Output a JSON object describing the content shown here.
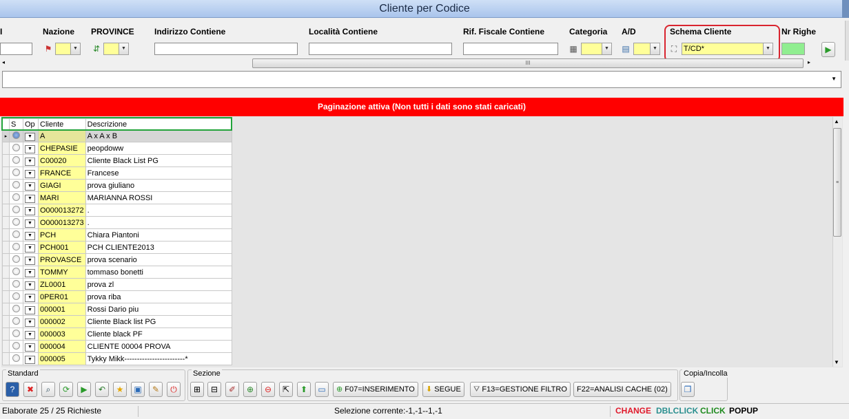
{
  "window": {
    "title": "Cliente per Codice"
  },
  "filters": {
    "nazione": "Nazione",
    "province": "PROVINCE",
    "indirizzo": "Indirizzo Contiene",
    "localita": "Località Contiene",
    "rif_fiscale": "Rif. Fiscale Contiene",
    "categoria": "Categoria",
    "ad": "A/D",
    "schema_cliente": "Schema Cliente",
    "schema_value": "T/CD*",
    "nr_righe": "Nr Righe",
    "left_fragment": "I"
  },
  "banner": "Paginazione attiva (Non tutti i dati sono stati caricati)",
  "grid": {
    "columns": [
      "S",
      "Op",
      "Cliente",
      "Descrizione"
    ],
    "rows": [
      {
        "cliente": "A",
        "descrizione": "A x A x B"
      },
      {
        "cliente": "CHEPASIE",
        "descrizione": "peopdoww"
      },
      {
        "cliente": "C00020",
        "descrizione": "Cliente Black List PG"
      },
      {
        "cliente": "FRANCE",
        "descrizione": "Francese"
      },
      {
        "cliente": "GIAGI",
        "descrizione": "prova giuliano"
      },
      {
        "cliente": "MARI",
        "descrizione": "MARIANNA ROSSI"
      },
      {
        "cliente": "O000013272",
        "descrizione": "."
      },
      {
        "cliente": "O000013273",
        "descrizione": "."
      },
      {
        "cliente": "PCH",
        "descrizione": "Chiara Piantoni"
      },
      {
        "cliente": "PCH001",
        "descrizione": "PCH CLIENTE2013"
      },
      {
        "cliente": "PROVASCE",
        "descrizione": "prova scenario"
      },
      {
        "cliente": "TOMMY",
        "descrizione": "tommaso bonetti"
      },
      {
        "cliente": "ZL0001",
        "descrizione": "prova zl"
      },
      {
        "cliente": "0PER01",
        "descrizione": "prova riba"
      },
      {
        "cliente": "000001",
        "descrizione": "Rossi Dario piu"
      },
      {
        "cliente": "000002",
        "descrizione": "Cliente Black list PG"
      },
      {
        "cliente": "000003",
        "descrizione": "Cliente black PF"
      },
      {
        "cliente": "000004",
        "descrizione": "CLIENTE 00004 PROVA"
      },
      {
        "cliente": "000005",
        "descrizione": "Tykky Mikk------------------------*"
      }
    ]
  },
  "toolbar": {
    "standard_label": "Standard",
    "sezione_label": "Sezione",
    "copia_label": "Copia/Incolla",
    "inserimento": "F07=INSERIMENTO",
    "segue": "SEGUE",
    "gestione_filtro": "F13=GESTIONE FILTRO",
    "analisi_cache": "F22=ANALISI CACHE (02)"
  },
  "status": {
    "elaborate": "Elaborate 25 / 25 Richieste",
    "selezione": "Selezione corrente:-1,-1--1,-1",
    "change": "CHANGE",
    "dblclick": "DBLCLICK",
    "click": "CLICK",
    "popup": "POPUP",
    "colors": {
      "change": "#e0192b",
      "dblclick": "#2a8f8f",
      "click": "#1e8a1e",
      "popup": "#000000"
    }
  }
}
